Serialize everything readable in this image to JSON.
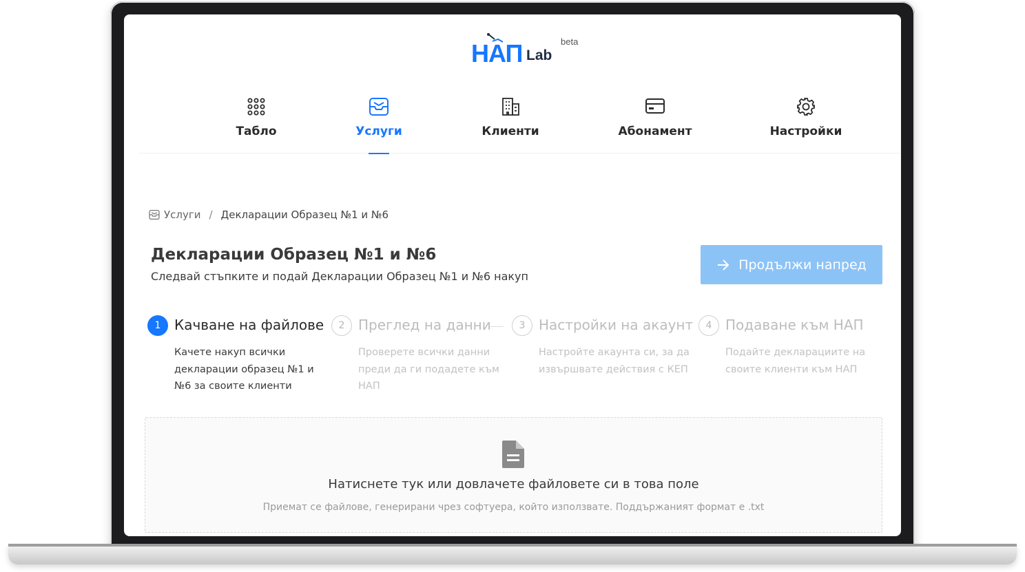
{
  "logo": {
    "brand": "НАП",
    "sub": "Lab",
    "badge": "beta"
  },
  "nav": {
    "items": [
      {
        "label": "Табло",
        "icon": "grid-dots-icon",
        "active": false
      },
      {
        "label": "Услуги",
        "icon": "inbox-icon",
        "active": true
      },
      {
        "label": "Клиенти",
        "icon": "building-icon",
        "active": false
      },
      {
        "label": "Абонамент",
        "icon": "credit-card-icon",
        "active": false
      },
      {
        "label": "Настройки",
        "icon": "gear-icon",
        "active": false
      }
    ]
  },
  "breadcrumb": {
    "root": "Услуги",
    "separator": "/",
    "current": "Декларации Образец №1 и №6"
  },
  "header": {
    "title": "Декларации Образец №1 и №6",
    "subtitle": "Следвай стъпките и подай Декларации Образец №1 и №6 накуп",
    "continue_label": "Продължи напред"
  },
  "steps": [
    {
      "number": "1",
      "title": "Качване на файлове",
      "desc": [
        "Качете накуп всички",
        "декларации образец №1 и",
        "№6 за своите клиенти"
      ],
      "active": true
    },
    {
      "number": "2",
      "title": "Преглед на данни",
      "desc": [
        "Проверете всички данни",
        "преди да ги подадете към",
        "НАП"
      ],
      "active": false
    },
    {
      "number": "3",
      "title": "Настройки на акаунт",
      "desc": [
        "Настройте акаунта си, за да",
        "извършвате действия с КЕП"
      ],
      "active": false
    },
    {
      "number": "4",
      "title": "Подаване към НАП",
      "desc": [
        "Подайте декларациите на",
        "своите клиенти към НАП"
      ],
      "active": false
    }
  ],
  "dropzone": {
    "text": "Натиснете тук или довлачете файловете си в това поле",
    "hint": "Приемат се файлове, генерирани чрез софтуера, който използвате. Поддържаният формат е .txt"
  },
  "colors": {
    "primary": "#1677ff",
    "button_disabled": "#8cc3f7",
    "muted": "#bdbdbd"
  }
}
